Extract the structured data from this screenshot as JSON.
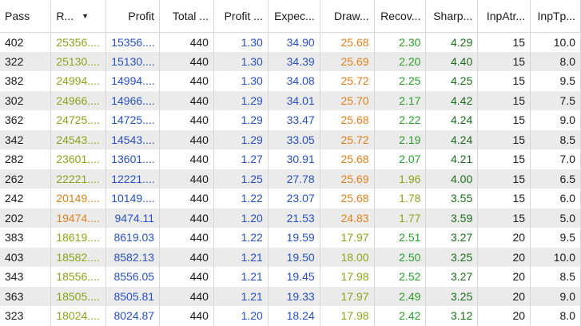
{
  "columns": [
    {
      "label": "Pass",
      "align": "left"
    },
    {
      "label": "R...",
      "align": "left",
      "sorted": true
    },
    {
      "label": "Profit",
      "align": "right"
    },
    {
      "label": "Total ...",
      "align": "right"
    },
    {
      "label": "Profit ...",
      "align": "right"
    },
    {
      "label": "Expec...",
      "align": "right"
    },
    {
      "label": "Draw...",
      "align": "right"
    },
    {
      "label": "Recov...",
      "align": "right"
    },
    {
      "label": "Sharp...",
      "align": "right"
    },
    {
      "label": "InpAtr...",
      "align": "right"
    },
    {
      "label": "InpTp...",
      "align": "right"
    }
  ],
  "colors": {
    "default": "#1a1a1a",
    "olive": "#8aa51a",
    "blue": "#2750c8",
    "orange": "#e0801a",
    "green": "#28a028",
    "darkgreen": "#1c6e1c",
    "row_alt": "#ebebeb",
    "grid": "#d7d7d7"
  },
  "rows": [
    {
      "cells": [
        "402",
        "25356....",
        "15356....",
        "440",
        "1.30",
        "34.90",
        "25.68",
        "2.30",
        "4.29",
        "15",
        "10.0"
      ],
      "colors": [
        "default",
        "olive",
        "blue",
        "default",
        "blue",
        "blue",
        "orange",
        "green",
        "darkgreen",
        "default",
        "default"
      ]
    },
    {
      "cells": [
        "322",
        "25130....",
        "15130....",
        "440",
        "1.30",
        "34.39",
        "25.69",
        "2.20",
        "4.40",
        "15",
        "8.0"
      ],
      "colors": [
        "default",
        "olive",
        "blue",
        "default",
        "blue",
        "blue",
        "orange",
        "green",
        "darkgreen",
        "default",
        "default"
      ]
    },
    {
      "cells": [
        "382",
        "24994....",
        "14994....",
        "440",
        "1.30",
        "34.08",
        "25.72",
        "2.25",
        "4.25",
        "15",
        "9.5"
      ],
      "colors": [
        "default",
        "olive",
        "blue",
        "default",
        "blue",
        "blue",
        "orange",
        "green",
        "darkgreen",
        "default",
        "default"
      ]
    },
    {
      "cells": [
        "302",
        "24966....",
        "14966....",
        "440",
        "1.29",
        "34.01",
        "25.70",
        "2.17",
        "4.42",
        "15",
        "7.5"
      ],
      "colors": [
        "default",
        "olive",
        "blue",
        "default",
        "blue",
        "blue",
        "orange",
        "green",
        "darkgreen",
        "default",
        "default"
      ]
    },
    {
      "cells": [
        "362",
        "24725....",
        "14725....",
        "440",
        "1.29",
        "33.47",
        "25.68",
        "2.22",
        "4.24",
        "15",
        "9.0"
      ],
      "colors": [
        "default",
        "olive",
        "blue",
        "default",
        "blue",
        "blue",
        "orange",
        "green",
        "darkgreen",
        "default",
        "default"
      ]
    },
    {
      "cells": [
        "342",
        "24543....",
        "14543....",
        "440",
        "1.29",
        "33.05",
        "25.72",
        "2.19",
        "4.24",
        "15",
        "8.5"
      ],
      "colors": [
        "default",
        "olive",
        "blue",
        "default",
        "blue",
        "blue",
        "orange",
        "green",
        "darkgreen",
        "default",
        "default"
      ]
    },
    {
      "cells": [
        "282",
        "23601....",
        "13601....",
        "440",
        "1.27",
        "30.91",
        "25.68",
        "2.07",
        "4.21",
        "15",
        "7.0"
      ],
      "colors": [
        "default",
        "olive",
        "blue",
        "default",
        "blue",
        "blue",
        "orange",
        "green",
        "darkgreen",
        "default",
        "default"
      ]
    },
    {
      "cells": [
        "262",
        "22221....",
        "12221....",
        "440",
        "1.25",
        "27.78",
        "25.69",
        "1.96",
        "4.00",
        "15",
        "6.5"
      ],
      "colors": [
        "default",
        "olive",
        "blue",
        "default",
        "blue",
        "blue",
        "orange",
        "olive",
        "darkgreen",
        "default",
        "default"
      ]
    },
    {
      "cells": [
        "242",
        "20149....",
        "10149....",
        "440",
        "1.22",
        "23.07",
        "25.68",
        "1.78",
        "3.55",
        "15",
        "6.0"
      ],
      "colors": [
        "default",
        "orange",
        "blue",
        "default",
        "blue",
        "blue",
        "orange",
        "olive",
        "darkgreen",
        "default",
        "default"
      ]
    },
    {
      "cells": [
        "202",
        "19474....",
        "9474.11",
        "440",
        "1.20",
        "21.53",
        "24.83",
        "1.77",
        "3.59",
        "15",
        "5.0"
      ],
      "colors": [
        "default",
        "orange",
        "blue",
        "default",
        "blue",
        "blue",
        "orange",
        "olive",
        "darkgreen",
        "default",
        "default"
      ]
    },
    {
      "cells": [
        "383",
        "18619....",
        "8619.03",
        "440",
        "1.22",
        "19.59",
        "17.97",
        "2.51",
        "3.27",
        "20",
        "9.5"
      ],
      "colors": [
        "default",
        "olive",
        "blue",
        "default",
        "blue",
        "blue",
        "olive",
        "green",
        "darkgreen",
        "default",
        "default"
      ]
    },
    {
      "cells": [
        "403",
        "18582....",
        "8582.13",
        "440",
        "1.21",
        "19.50",
        "18.00",
        "2.50",
        "3.25",
        "20",
        "10.0"
      ],
      "colors": [
        "default",
        "olive",
        "blue",
        "default",
        "blue",
        "blue",
        "olive",
        "green",
        "darkgreen",
        "default",
        "default"
      ]
    },
    {
      "cells": [
        "343",
        "18556....",
        "8556.05",
        "440",
        "1.21",
        "19.45",
        "17.98",
        "2.52",
        "3.27",
        "20",
        "8.5"
      ],
      "colors": [
        "default",
        "olive",
        "blue",
        "default",
        "blue",
        "blue",
        "olive",
        "green",
        "darkgreen",
        "default",
        "default"
      ]
    },
    {
      "cells": [
        "363",
        "18505....",
        "8505.81",
        "440",
        "1.21",
        "19.33",
        "17.97",
        "2.49",
        "3.25",
        "20",
        "9.0"
      ],
      "colors": [
        "default",
        "olive",
        "blue",
        "default",
        "blue",
        "blue",
        "olive",
        "green",
        "darkgreen",
        "default",
        "default"
      ]
    },
    {
      "cells": [
        "323",
        "18024....",
        "8024.87",
        "440",
        "1.20",
        "18.24",
        "17.98",
        "2.42",
        "3.12",
        "20",
        "8.0"
      ],
      "colors": [
        "default",
        "olive",
        "blue",
        "default",
        "blue",
        "blue",
        "olive",
        "green",
        "darkgreen",
        "default",
        "default"
      ]
    }
  ]
}
